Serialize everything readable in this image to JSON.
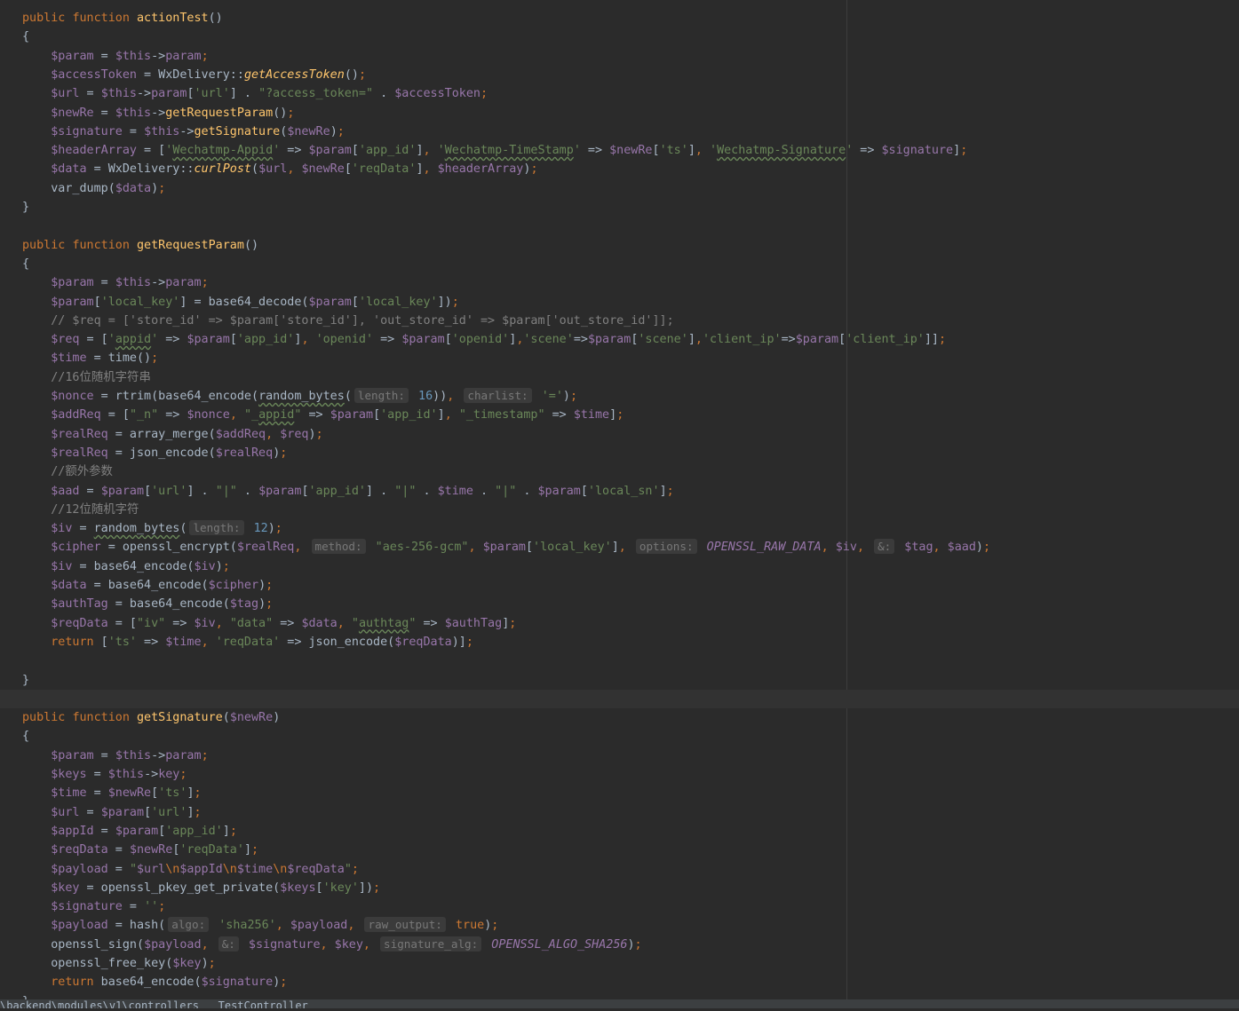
{
  "editor": {
    "language": "PHP",
    "lines": [
      "public function actionTest()",
      "{",
      "    $param = $this->param;",
      "    $accessToken = WxDelivery::getAccessToken();",
      "    $url = $this->param['url'] . \"?access_token=\" . $accessToken;",
      "    $newRe = $this->getRequestParam();",
      "    $signature = $this->getSignature($newRe);",
      "    $headerArray = ['Wechatmp-Appid' => $param['app_id'], 'Wechatmp-TimeStamp' => $newRe['ts'], 'Wechatmp-Signature' => $signature];",
      "    $data = WxDelivery::curlPost($url, $newRe['reqData'], $headerArray);",
      "    var_dump($data);",
      "}",
      "",
      "public function getRequestParam()",
      "{",
      "    $param = $this->param;",
      "    $param['local_key'] = base64_decode($param['local_key']);",
      "    // $req = ['store_id' => $param['store_id'], 'out_store_id' => $param['out_store_id']];",
      "    $req = ['appid' => $param['app_id'], 'openid' => $param['openid'],'scene'=>$param['scene'],'client_ip'=>$param['client_ip']];",
      "    $time = time();",
      "    //16位随机字符串",
      "    $nonce = rtrim(base64_encode(random_bytes( length: 16)),  charlist: '=');",
      "    $addReq = [\"_n\" => $nonce, \"_appid\" => $param['app_id'], \"_timestamp\" => $time];",
      "    $realReq = array_merge($addReq, $req);",
      "    $realReq = json_encode($realReq);",
      "    //额外参数",
      "    $aad = $param['url'] . \"|\" . $param['app_id'] . \"|\" . $time . \"|\" . $param['local_sn'];",
      "    //12位随机字符",
      "    $iv = random_bytes( length: 12);",
      "    $cipher = openssl_encrypt($realReq,  method: \"aes-256-gcm\", $param['local_key'],  options: OPENSSL_RAW_DATA, $iv,  &: $tag, $aad);",
      "    $iv = base64_encode($iv);",
      "    $data = base64_encode($cipher);",
      "    $authTag = base64_encode($tag);",
      "    $reqData = [\"iv\" => $iv, \"data\" => $data, \"authtag\" => $authTag];",
      "    return ['ts' => $time, 'reqData' => json_encode($reqData)];",
      "",
      "}",
      "",
      "public function getSignature($newRe)",
      "{",
      "    $param = $this->param;",
      "    $keys = $this->key;",
      "    $time = $newRe['ts'];",
      "    $url = $param['url'];",
      "    $appId = $param['app_id'];",
      "    $reqData = $newRe['reqData'];",
      "    $payload = \"$url\\n$appId\\n$time\\n$reqData\";",
      "    $key = openssl_pkey_get_private($keys['key']);",
      "    $signature = '';",
      "    $payload = hash( algo: 'sha256', $payload,  raw_output: true);",
      "    openssl_sign($payload,  &: $signature, $key,  signature_alg: OPENSSL_ALGO_SHA256);",
      "    openssl_free_key($key);",
      "    return base64_encode($signature);",
      "}"
    ],
    "bottom_path": "\\backend\\modules\\v1\\controllers   TestController"
  }
}
